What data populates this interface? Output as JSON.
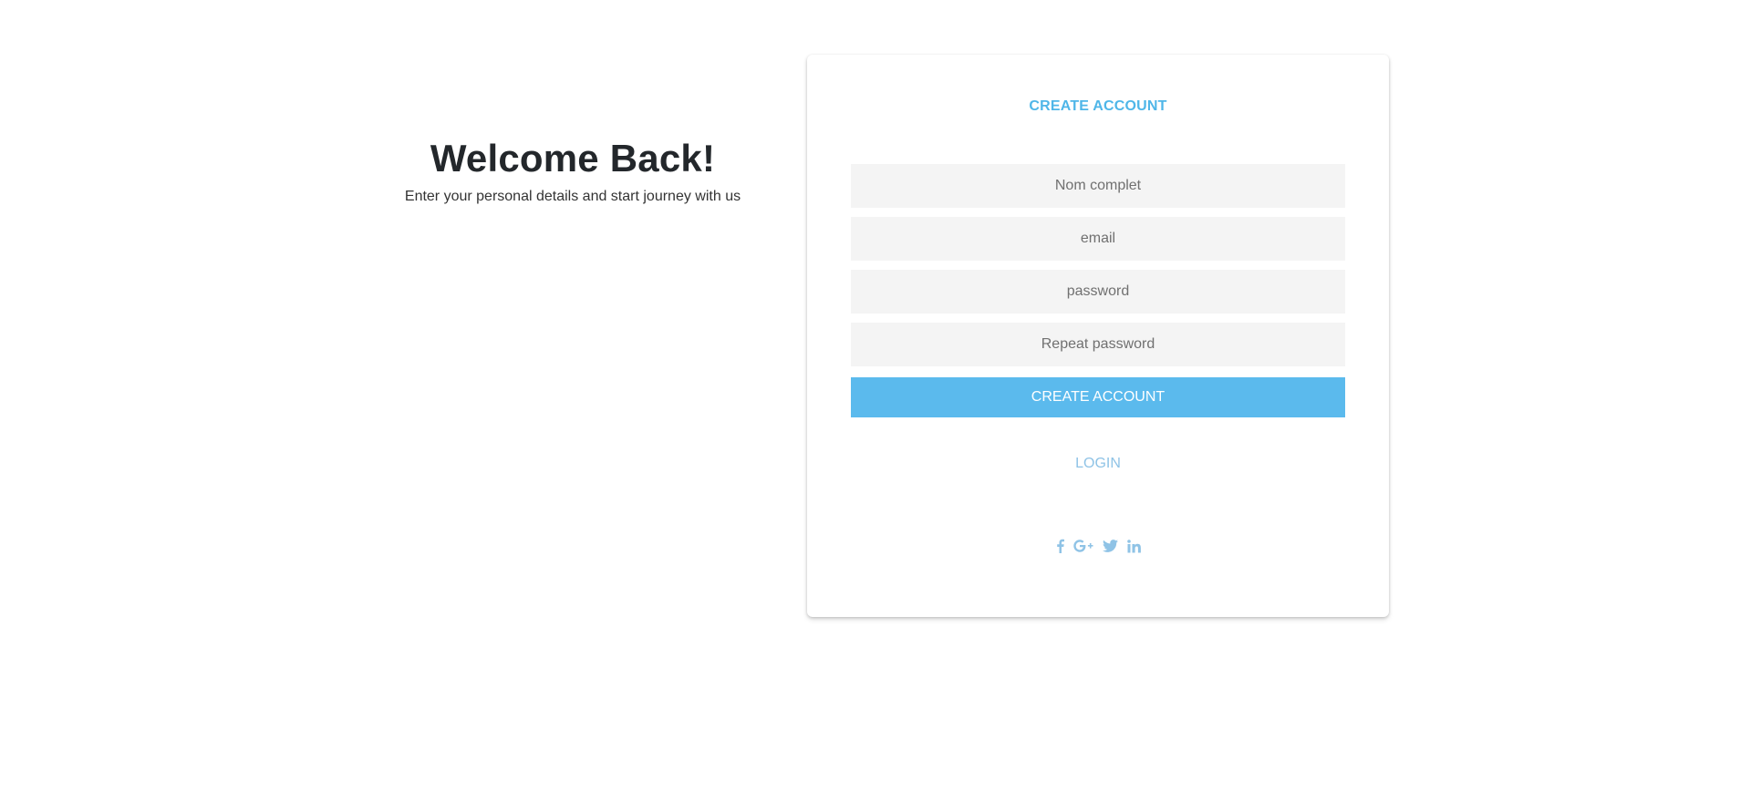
{
  "welcome": {
    "heading": "Welcome Back!",
    "subtext": "Enter your personal details and start journey with us"
  },
  "form": {
    "title": "CREATE ACCOUNT",
    "fields": [
      {
        "placeholder": "Nom complet",
        "value": ""
      },
      {
        "placeholder": "email",
        "value": ""
      },
      {
        "placeholder": "password",
        "value": ""
      },
      {
        "placeholder": "Repeat password",
        "value": ""
      }
    ],
    "submit_label": "CREATE ACCOUNT",
    "login_label": "LOGIN",
    "social_icons": [
      "facebook-icon",
      "google-plus-icon",
      "twitter-icon",
      "linkedin-icon"
    ]
  },
  "colors": {
    "accent": "#5bbaed",
    "title": "#4fb6e8",
    "link": "#8fc3e6",
    "field_bg": "#f4f4f4"
  }
}
